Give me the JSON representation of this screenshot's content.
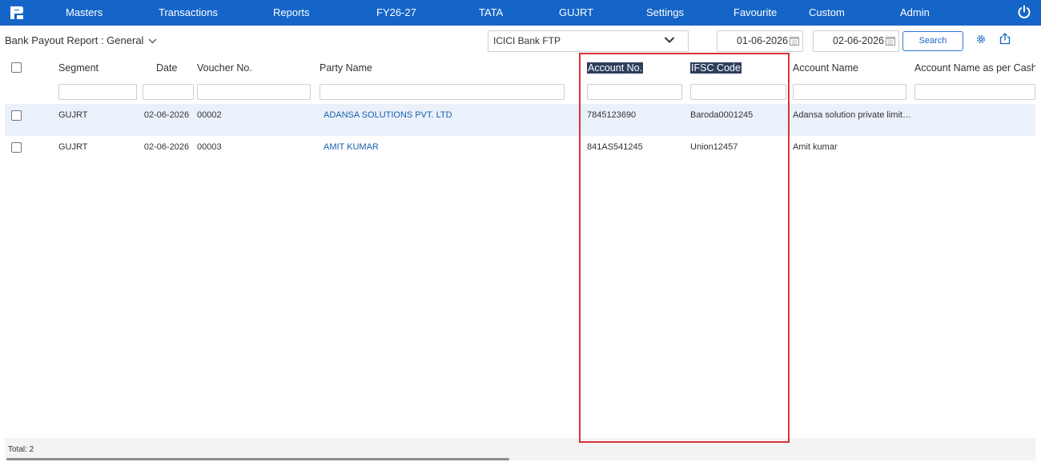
{
  "nav": {
    "items": [
      {
        "id": "masters",
        "label": "Masters"
      },
      {
        "id": "transactions",
        "label": "Transactions"
      },
      {
        "id": "reports",
        "label": "Reports"
      },
      {
        "id": "fy",
        "label": "FY26-27"
      },
      {
        "id": "tata",
        "label": "TATA"
      },
      {
        "id": "gujrt",
        "label": "GUJRT"
      },
      {
        "id": "settings",
        "label": "Settings"
      },
      {
        "id": "favourite",
        "label": "Favourite"
      },
      {
        "id": "custom",
        "label": "Custom"
      },
      {
        "id": "admin",
        "label": "Admin"
      }
    ],
    "color": "#1565c8"
  },
  "toolbar": {
    "report_title": "Bank Payout Report : General",
    "bank": "ICICI Bank FTP",
    "from_date": "01-06-2026",
    "to_date": "02-06-2026",
    "search_label": "Search"
  },
  "grid": {
    "columns": [
      "Segment",
      "Date",
      "Voucher No.",
      "Party Name",
      "Account No.",
      "IFSC Code",
      "Account Name",
      "Account Name as per Cashl"
    ],
    "rows": [
      {
        "segment": "GUJRT",
        "date": "02-06-2026",
        "voucher": "00002",
        "party": "ADANSA SOLUTIONS PVT. LTD",
        "account_no": "7845123690",
        "ifsc": "Baroda0001245",
        "account_name": "Adansa solution private limited",
        "account_name_cash": ""
      },
      {
        "segment": "GUJRT",
        "date": "02-06-2026",
        "voucher": "00003",
        "party": "AMIT KUMAR",
        "account_no": "841AS541245",
        "ifsc": "Union12457",
        "account_name": "Amit kumar",
        "account_name_cash": ""
      }
    ]
  },
  "footer": {
    "total": "Total: 2"
  },
  "colors": {
    "highlight_border": "#d9323a",
    "row_highlight": "#eaf1fb",
    "selected_header": "#2e3f5c",
    "link": "#1a5fae"
  }
}
